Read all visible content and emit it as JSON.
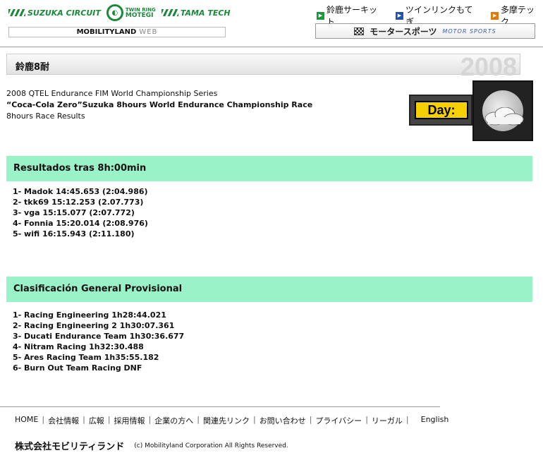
{
  "header": {
    "logos": {
      "suzuka": "SUZUKA CIRCUIT",
      "motegi_small": "TWIN RING",
      "motegi": "MOTEGI",
      "tamatech": "TAMA TECH"
    },
    "mobilityland": "MOBILITYLAND",
    "web": "WEB",
    "links": [
      "鈴鹿サーキット",
      "ツインリンクもてぎ",
      "多摩テック"
    ],
    "link_colors": [
      "#1a9a3a",
      "#2255aa",
      "#e07a10"
    ],
    "motor_sports_jp": "モータースポーツ",
    "motor_sports_en": "MOTOR SPORTS"
  },
  "title": {
    "text": "鈴鹿8耐",
    "year": "2008"
  },
  "intro": {
    "line1": "2008 QTEL Endurance FIM World Championship Series",
    "line2": "“Coca-Cola Zero”Suzuka 8hours World Endurance Championship Race",
    "line3": "8hours Race Results"
  },
  "badge": {
    "label": "Day:",
    "icon": "moon-cloud-icon"
  },
  "section1": {
    "title": "Resultados tras 8h:00min",
    "items": [
      "1- Madok 14:45.653 (2:04.986)",
      "2- tkk69 15:12.253 (2.07.773)",
      "3- vga 15:15.077 (2:07.772)",
      "4- Fonnia 15:20.014 (2:08.976)",
      "5- wifi 16:15.943 (2:11.180)"
    ]
  },
  "section2": {
    "title": "Clasificación General Provisional",
    "items": [
      "1- Racing Engineering 1h28:44.021",
      "2- Racing Engineering 2 1h30:07.361",
      "3- Ducati Endurance Team 1h30:36.677",
      "4- Nitram Racing 1h32:30.488",
      "5- Ares Racing Team 1h35:55.182",
      "6- Burn Out Team Racing DNF"
    ]
  },
  "footer": {
    "nav": [
      "HOME",
      "会社情報",
      "広報",
      "採用情報",
      "企業の方へ",
      "関連先リンク",
      "お問い合わせ",
      "プライバシー",
      "リーガル"
    ],
    "english": "English",
    "company": "株式会社モビリティランド",
    "copyright": "(c) Mobilityland Corporation All Rights Reserved."
  }
}
